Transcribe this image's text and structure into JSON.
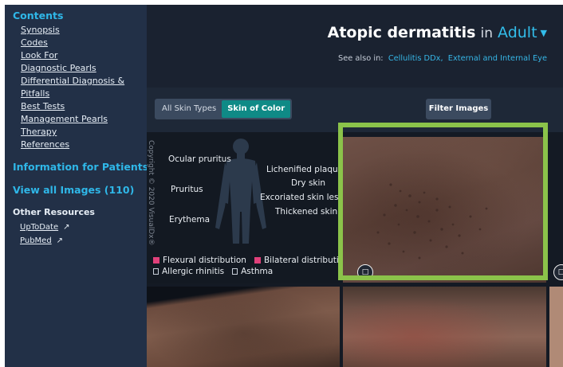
{
  "sidebar": {
    "contents_label": "Contents",
    "contents_links": [
      "Synopsis",
      "Codes",
      "Look For",
      "Diagnostic Pearls",
      "Differential Diagnosis &",
      "Pitfalls",
      "Best Tests",
      "Management Pearls",
      "Therapy",
      "References"
    ],
    "patients_label": "Information for Patients",
    "view_all_label": "View all Images (110)",
    "other_resources_label": "Other Resources",
    "resources": [
      "UpToDate",
      "PubMed"
    ]
  },
  "header": {
    "title_condition": "Atopic dermatitis",
    "title_in": "in",
    "title_population": "Adult",
    "see_also_label": "See also in:",
    "see_also_links": [
      "Cellulitis DDx,",
      "External and Internal Eye"
    ]
  },
  "toolbar": {
    "skin_types": [
      "All Skin Types",
      "Skin of Color"
    ],
    "active_skin_type": "Skin of Color",
    "filter_label": "Filter Images"
  },
  "diagram": {
    "copyright": "Copyright © 2020 VisualDx®",
    "labels_left": [
      "Ocular pruritus",
      "Pruritus",
      "Erythema"
    ],
    "labels_right": [
      "Lichenified plaque",
      "Dry skin",
      "Excoriated skin lesio",
      "Thickened skin"
    ],
    "legend_distribution": [
      "Flexural distribution",
      "Bilateral distribution"
    ],
    "legend_history": [
      "Allergic rhinitis",
      "Asthma"
    ]
  },
  "colors": {
    "accent": "#2fb7e8",
    "active_toggle": "#0f8a86",
    "highlight_border": "#8bc34a",
    "legend_marker": "#e0407a"
  },
  "icons": [
    "external-link-icon",
    "comment-icon",
    "chevron-down-icon",
    "calendar-icon",
    "human-silhouette-icon"
  ]
}
